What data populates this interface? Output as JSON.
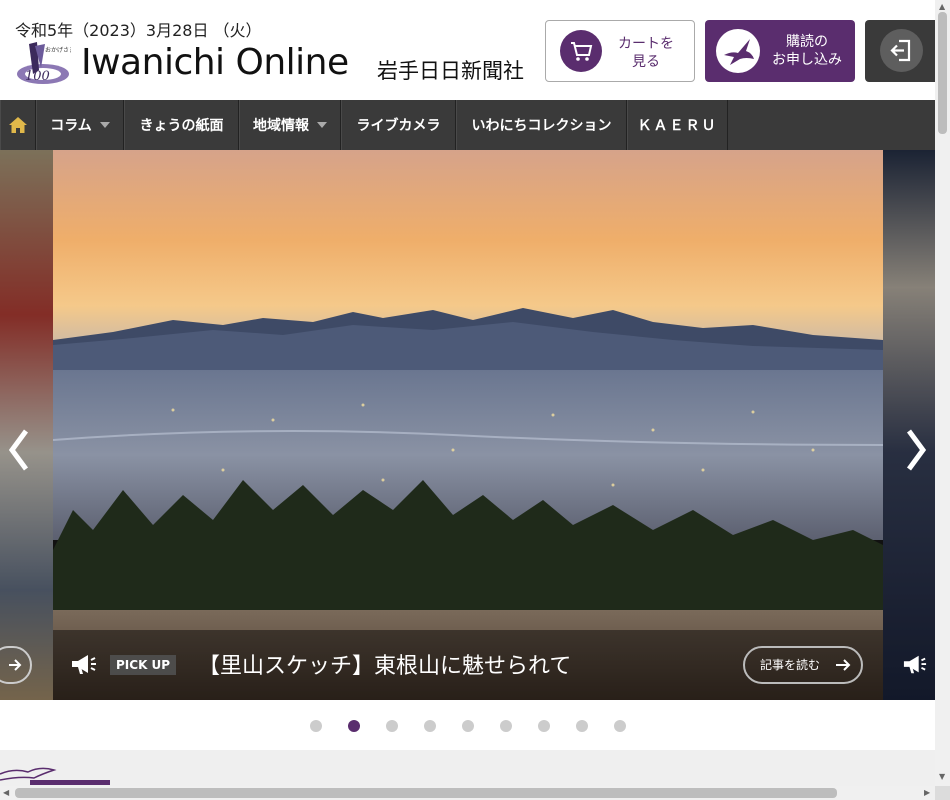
{
  "header": {
    "date": "令和5年（2023）3月28日 （火）",
    "logo_small_text": "おかげさまで100周年",
    "logo_text": "Iwanichi Online",
    "logo_subtitle": "岩手日日新聞社",
    "cart_button": {
      "line1": "カートを",
      "line2": "見る",
      "icon": "cart-icon"
    },
    "subscribe_button": {
      "line1": "購読の",
      "line2": "お申し込み",
      "icon": "dove-icon"
    },
    "login_button": {
      "icon": "login-icon"
    }
  },
  "nav": {
    "home_icon": "home-icon",
    "items": [
      {
        "label": "コラム",
        "has_dropdown": true
      },
      {
        "label": "きょうの紙面",
        "has_dropdown": false
      },
      {
        "label": "地域情報",
        "has_dropdown": true
      },
      {
        "label": "ライブカメラ",
        "has_dropdown": false
      },
      {
        "label": "いわにちコレクション",
        "has_dropdown": false
      },
      {
        "label": "ＫＡＥＲＵ",
        "has_dropdown": false
      }
    ]
  },
  "slider": {
    "tag": "PICK UP",
    "title": "【里山スケッチ】東根山に魅せられて",
    "read_more": "記事を読む",
    "slide_count": 9,
    "active_index": 1
  },
  "colors": {
    "brand_purple": "#5a2d6e",
    "nav_bg": "#3a3a3a",
    "dot_inactive": "#cccccc"
  }
}
